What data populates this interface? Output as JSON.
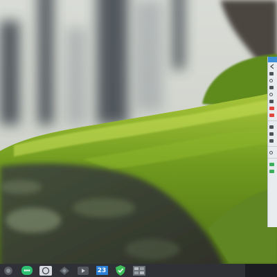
{
  "desktop": {
    "wallpaper_icon": "moss-photo-wallpaper"
  },
  "side_panel": {
    "icons": [
      "back-icon",
      "menu-icon",
      "settings-icon",
      "list-icon",
      "grid-icon",
      "alert-icon",
      "folder-icon",
      "chart-icon",
      "share-icon",
      "status-icon"
    ],
    "accent_color": "#3d8fd8"
  },
  "taskbar": {
    "launchers": [
      {
        "name": "start-menu-icon"
      },
      {
        "name": "chat-app-icon",
        "color": "#2fbf71"
      },
      {
        "name": "whatsapp-icon"
      },
      {
        "name": "vpn-app-icon"
      },
      {
        "name": "video-player-icon"
      },
      {
        "name": "calendar-icon",
        "badge": "23"
      },
      {
        "name": "shield-check-icon",
        "color": "#3fbf5a"
      },
      {
        "name": "window-manager-icon"
      }
    ],
    "background": "#2f3136"
  }
}
